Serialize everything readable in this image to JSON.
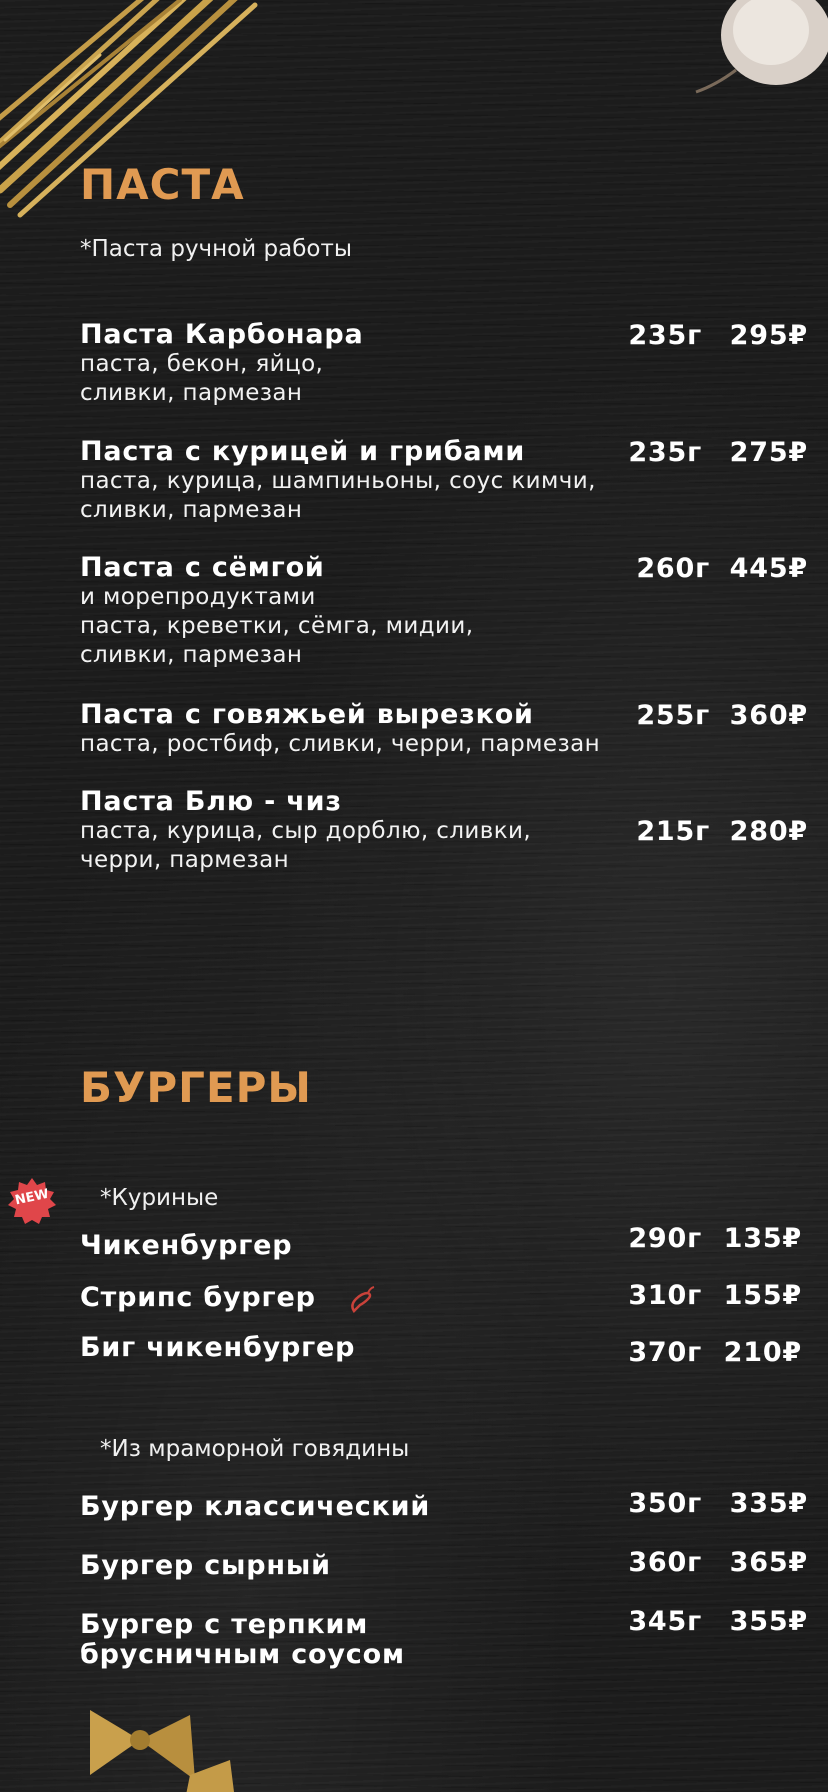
{
  "pasta": {
    "title": "ПАСТА",
    "note": "*Паста ручной работы",
    "items": [
      {
        "name": "Паста Карбонара",
        "desc": [
          "паста, бекон, яйцо,",
          "сливки, пармезан"
        ],
        "weight": "235г",
        "price": "295₽"
      },
      {
        "name": "Паста с курицей и грибами",
        "desc": [
          "паста, курица, шампиньоны, соус кимчи,",
          "сливки, пармезан"
        ],
        "weight": "235г",
        "price": "275₽"
      },
      {
        "name": "Паста с сёмгой",
        "desc": [
          "и морепродуктами",
          "паста, креветки, сёмга, мидии,",
          "сливки, пармезан"
        ],
        "weight": "260г",
        "price": "445₽"
      },
      {
        "name": "Паста с говяжьей вырезкой",
        "desc": [
          "паста, ростбиф, сливки, черри, пармезан"
        ],
        "weight": "255г",
        "price": "360₽"
      },
      {
        "name": "Паста Блю - чиз",
        "desc": [
          "паста, курица, сыр дорблю, сливки,",
          "черри, пармезан"
        ],
        "weight": "215г",
        "price": "280₽"
      }
    ]
  },
  "burgers": {
    "title": "БУРГЕРЫ",
    "badge": "NEW",
    "chicken_note": "*Куриные",
    "chicken_items": [
      {
        "name": "Чикенбургер",
        "weight": "290г",
        "price": "135₽"
      },
      {
        "name": "Стрипс бургер",
        "weight": "310г",
        "price": "155₽",
        "icon": "chili-pepper-icon"
      },
      {
        "name": "Биг чикенбургер",
        "weight": "370г",
        "price": "210₽"
      }
    ],
    "beef_note": "*Из мраморной говядины",
    "beef_items": [
      {
        "name": "Бургер классический",
        "weight": "350г",
        "price": "335₽"
      },
      {
        "name": "Бургер сырный",
        "weight": "360г",
        "price": "365₽"
      },
      {
        "name": [
          "Бургер с терпким",
          "брусничным соусом"
        ],
        "weight": "345г",
        "price": "355₽"
      }
    ]
  },
  "colors": {
    "accent": "#e09a52",
    "background": "#1c1c1c",
    "badge": "#e0464a",
    "chili": "#c9423a"
  }
}
